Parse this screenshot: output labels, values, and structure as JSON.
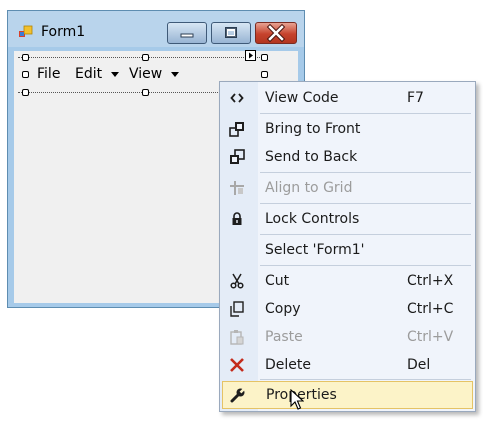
{
  "window": {
    "title": "Form1",
    "icon": "form-app-icon"
  },
  "menu_strip": {
    "items": [
      {
        "label": "File",
        "has_dropdown": false
      },
      {
        "label": "Edit",
        "has_dropdown": true
      },
      {
        "label": "View",
        "has_dropdown": true
      }
    ]
  },
  "context_menu": {
    "items": [
      {
        "label": "View Code",
        "shortcut": "F7",
        "icon": "code-brackets-icon",
        "disabled": false
      },
      {
        "label": "Bring to Front",
        "shortcut": "",
        "icon": "bring-to-front-icon",
        "disabled": false
      },
      {
        "label": "Send to Back",
        "shortcut": "",
        "icon": "send-to-back-icon",
        "disabled": false
      },
      {
        "label": "Align to Grid",
        "shortcut": "",
        "icon": "align-to-grid-icon",
        "disabled": true
      },
      {
        "label": "Lock Controls",
        "shortcut": "",
        "icon": "lock-icon",
        "disabled": false
      },
      {
        "label": "Select 'Form1'",
        "shortcut": "",
        "icon": "",
        "disabled": false
      },
      {
        "label": "Cut",
        "shortcut": "Ctrl+X",
        "icon": "scissors-icon",
        "disabled": false
      },
      {
        "label": "Copy",
        "shortcut": "Ctrl+C",
        "icon": "copy-icon",
        "disabled": false
      },
      {
        "label": "Paste",
        "shortcut": "Ctrl+V",
        "icon": "paste-icon",
        "disabled": true
      },
      {
        "label": "Delete",
        "shortcut": "Del",
        "icon": "delete-x-icon",
        "disabled": false
      },
      {
        "label": "Properties",
        "shortcut": "",
        "icon": "wrench-icon",
        "disabled": false,
        "highlighted": true
      }
    ]
  },
  "colors": {
    "menu_background": "#f0f4fb",
    "highlight": "#fcf3c8",
    "delete_icon": "#c42b1c"
  }
}
